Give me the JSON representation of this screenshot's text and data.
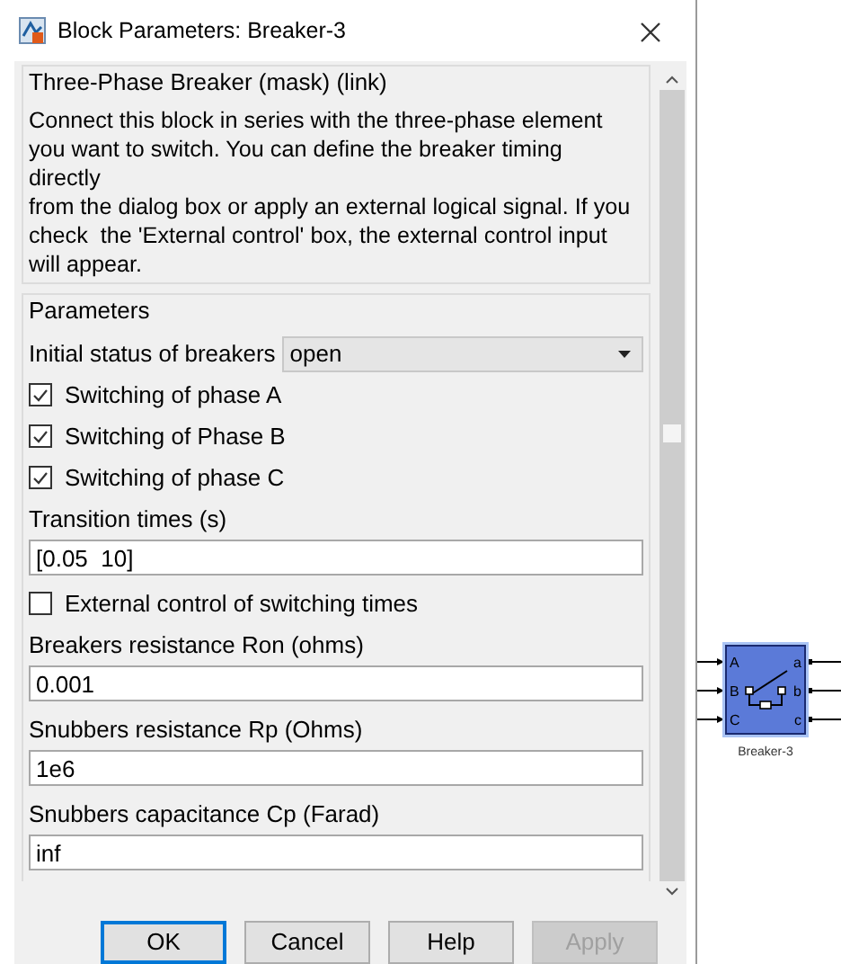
{
  "window": {
    "title": "Block Parameters: Breaker-3"
  },
  "description": {
    "title": "Three-Phase Breaker (mask) (link)",
    "text": "Connect this block in series with the three-phase element you want to switch. You can define the breaker timing\ndirectly\nfrom the dialog box or apply an external logical signal. If you check  the 'External control' box, the external control input will appear."
  },
  "parameters": {
    "title": "Parameters",
    "items": [
      {
        "kind": "dropdown",
        "label": "Initial status of breakers",
        "value": "open"
      },
      {
        "kind": "checkbox",
        "label": "Switching of phase A",
        "checked": true
      },
      {
        "kind": "checkbox",
        "label": "Switching of Phase B",
        "checked": true
      },
      {
        "kind": "checkbox",
        "label": "Switching of phase C",
        "checked": true
      },
      {
        "kind": "text",
        "label": "Transition times (s)",
        "value": "[0.05  10]"
      },
      {
        "kind": "checkbox",
        "label": "External control of switching times",
        "checked": false
      },
      {
        "kind": "text",
        "label": "Breakers resistance Ron (ohms)",
        "value": "0.001"
      },
      {
        "kind": "text",
        "label": "Snubbers resistance Rp (Ohms)",
        "value": "1e6"
      },
      {
        "kind": "text",
        "label": "Snubbers capacitance Cp (Farad)",
        "value": "inf"
      }
    ]
  },
  "buttons": [
    {
      "label": "OK",
      "focused": true,
      "disabled": false
    },
    {
      "label": "Cancel",
      "focused": false,
      "disabled": false
    },
    {
      "label": "Help",
      "focused": false,
      "disabled": false
    },
    {
      "label": "Apply",
      "focused": false,
      "disabled": true
    }
  ],
  "diagram": {
    "block": {
      "name": "Breaker-3",
      "inputs": [
        "A",
        "B",
        "C"
      ],
      "outputs": [
        "a",
        "b",
        "c"
      ]
    }
  }
}
